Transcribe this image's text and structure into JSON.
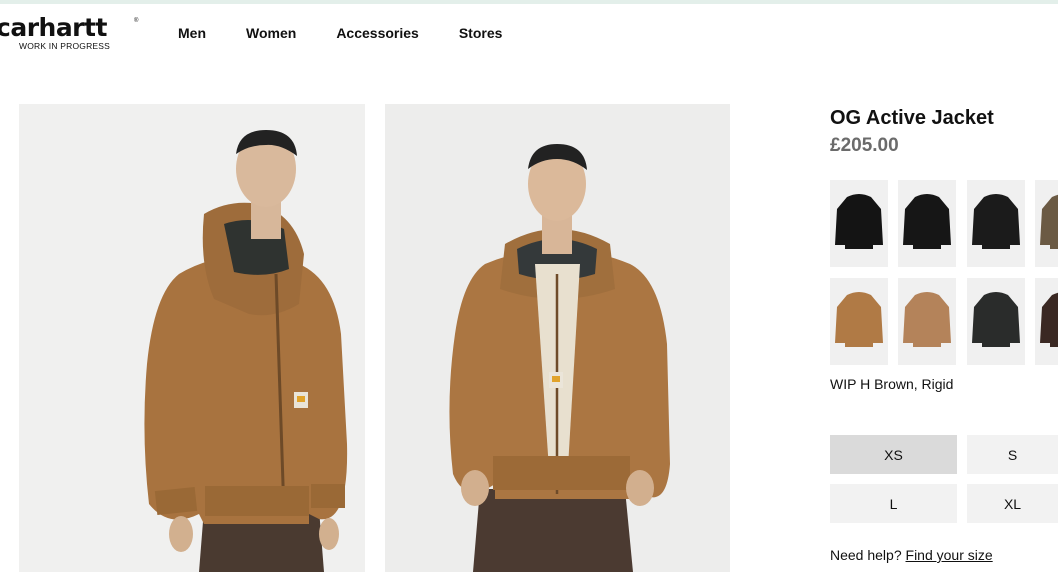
{
  "brand": {
    "name": "carhartt",
    "registered": "®",
    "tagline": "WORK IN PROGRESS"
  },
  "nav": {
    "items": [
      {
        "label": "Men"
      },
      {
        "label": "Women"
      },
      {
        "label": "Accessories"
      },
      {
        "label": "Stores"
      }
    ]
  },
  "product": {
    "title": "OG Active Jacket",
    "price": "£205.00",
    "selected_color": "WIP H Brown, Rigid",
    "swatches": [
      {
        "color": "#141414"
      },
      {
        "color": "#161616"
      },
      {
        "color": "#1b1b1b"
      },
      {
        "color": "#6b5a44"
      },
      {
        "color": "#b07a45"
      },
      {
        "color": "#b4835a"
      },
      {
        "color": "#2a2c2b"
      },
      {
        "color": "#3a2823"
      }
    ],
    "sizes": [
      {
        "label": "XS",
        "selected": true
      },
      {
        "label": "S",
        "selected": false
      },
      {
        "label": "L",
        "selected": false
      },
      {
        "label": "XL",
        "selected": false
      }
    ]
  },
  "help": {
    "text": "Need help?",
    "link": "Find your size"
  },
  "colors": {
    "jacket": "#a87440",
    "accent_line": "#e3efea"
  }
}
